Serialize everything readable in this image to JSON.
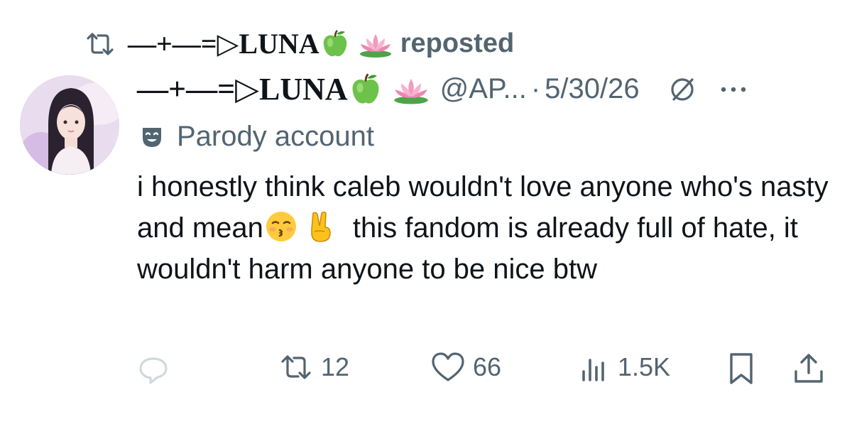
{
  "repost": {
    "name_prefix": "—+—=▷LUNA",
    "label": "reposted"
  },
  "post": {
    "display_name": "—+—=▷LUNA",
    "handle": "@AP...",
    "separator": "·",
    "date": "5/30/26",
    "parody_label": "Parody account",
    "text_parts": [
      "i honestly think caleb wouldn't love anyone who's nasty and mean",
      "this fandom is already full of hate, it wouldn't harm anyone to be nice btw"
    ]
  },
  "actions": {
    "reposts": "12",
    "likes": "66",
    "views": "1.5K"
  },
  "colors": {
    "text": "#0f1419",
    "muted": "#536471",
    "reply_icon": "#cfd9de"
  },
  "icons": [
    "repost-icon",
    "apple-emoji",
    "lotus-emoji",
    "grok-icon",
    "more-icon",
    "theater-mask-icon",
    "kissing-face-emoji",
    "victory-hand-emoji",
    "reply-icon",
    "heart-icon",
    "views-icon",
    "bookmark-icon",
    "share-icon"
  ]
}
